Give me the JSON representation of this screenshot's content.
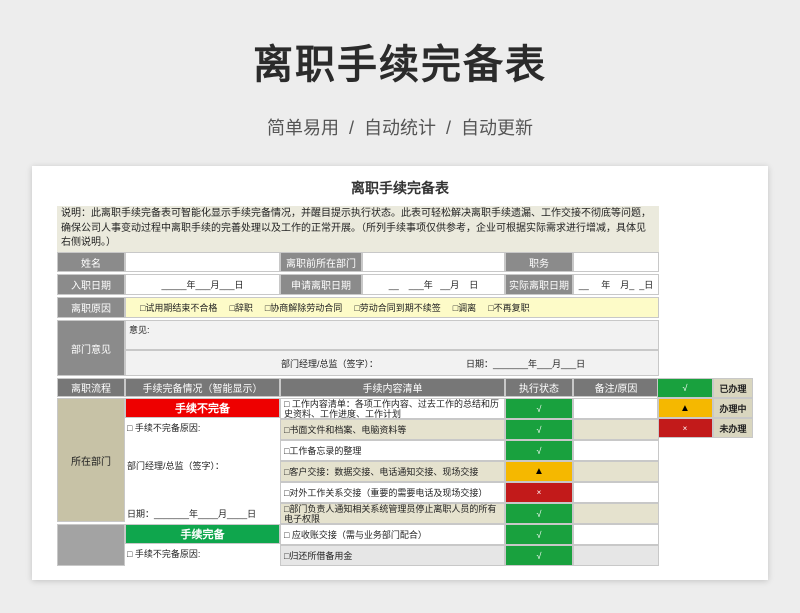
{
  "hero": {
    "title": "离职手续完备表",
    "subtitle": "简单易用  /  自动统计  /  自动更新"
  },
  "sheet": {
    "title": "离职手续完备表",
    "description": "说明：此离职手续完备表可智能化显示手续完备情况，并醒目提示执行状态。此表可轻松解决离职手续遗漏、工作交接不彻底等问题，确保公司人事变动过程中离职手续的完善处理以及工作的正常开展。（所列手续事项仅供参考，企业可根据实际需求进行增减，具体见右侧说明。）",
    "labels": {
      "name": "姓名",
      "dept": "离职前所在部门",
      "position": "职务",
      "entry_date": "入职日期",
      "apply_date": "申请离职日期",
      "actual_date": "实际离职日期",
      "reason": "离职原因",
      "dept_opinion": "部门意见",
      "flow": "离职流程"
    },
    "dates": {
      "entry": "_____年___月___日",
      "apply": "__    ___年   __月    日",
      "actual": "__     年    月_  _日"
    },
    "reasons": [
      "□试用期结束不合格",
      "□辞职",
      "□协商解除劳动合同",
      "□劳动合同到期不续签",
      "□调离",
      "□不再复职"
    ],
    "opinion": {
      "label": "意见:",
      "sign": "部门经理/总监（签字）：",
      "date": "日期：_______年___月___日"
    },
    "table_headers": {
      "status_smart": "手续完备情况（智能显示）",
      "content": "手续内容清单",
      "exec": "执行状态",
      "note": "备注/原因"
    },
    "legend": [
      {
        "symbol": "√",
        "label": "已办理"
      },
      {
        "symbol": "▲",
        "label": "办理中"
      },
      {
        "symbol": "×",
        "label": "未办理"
      }
    ],
    "section1": {
      "name": "所在部门",
      "banner": "手续不完备",
      "reason_label": "□ 手续不完备原因:",
      "sign": "部门经理/总监（签字）：",
      "date": "日期：_______年____月____日",
      "items": [
        {
          "text": "□ 工作内容清单：各项工作内容、过去工作的总结和历史资料、工作进度、工作计划",
          "status": "√"
        },
        {
          "text": "□书面文件和档案、电脑资料等",
          "status": "√"
        },
        {
          "text": "□工作备忘录的整理",
          "status": "√"
        },
        {
          "text": "□客户交接：数据交接、电话通知交接、现场交接",
          "status": "▲"
        },
        {
          "text": "□对外工作关系交接（重要的需要电话及现场交接）",
          "status": "×"
        },
        {
          "text": "□部门负责人通知相关系统管理员停止离职人员的所有电子权限",
          "status": "√"
        }
      ]
    },
    "section2": {
      "banner": "手续完备",
      "reason_label": "□ 手续不完备原因:",
      "items": [
        {
          "text": "□ 应收账交接（需与业务部门配合）",
          "status": "√"
        },
        {
          "text": "□归还所借备用金",
          "status": "√"
        }
      ]
    }
  }
}
